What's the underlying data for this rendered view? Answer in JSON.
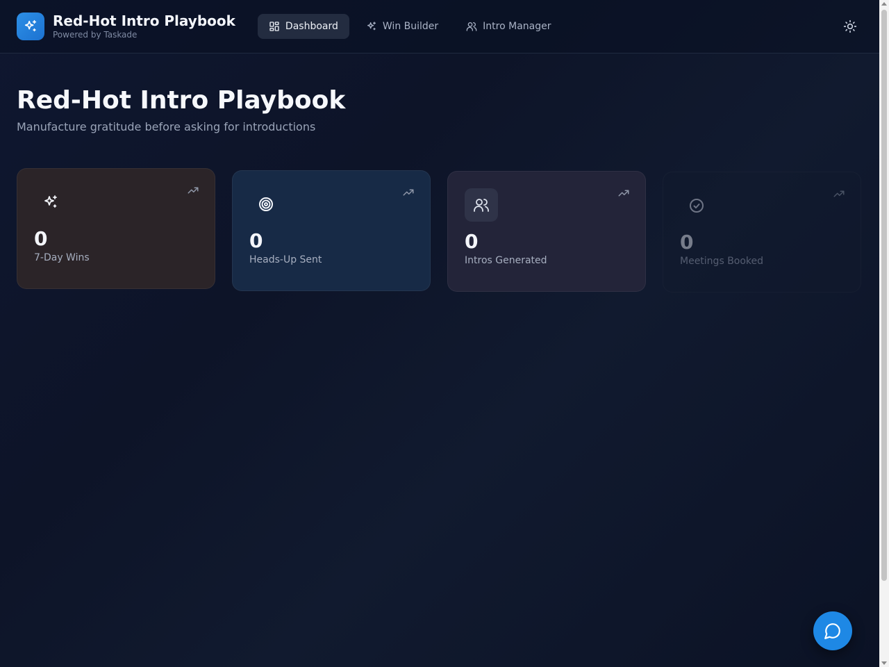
{
  "header": {
    "app_title": "Red-Hot Intro Playbook",
    "app_subtitle": "Powered by Taskade",
    "logo_icon": "sparkles-icon",
    "nav": [
      {
        "label": "Dashboard",
        "icon": "grid-icon",
        "active": true
      },
      {
        "label": "Win Builder",
        "icon": "sparkles-icon",
        "active": false
      },
      {
        "label": "Intro Manager",
        "icon": "users-icon",
        "active": false
      }
    ],
    "theme_icon": "sun-icon"
  },
  "main": {
    "title": "Red-Hot Intro Playbook",
    "subtitle": "Manufacture gratitude before asking for introductions",
    "stats": [
      {
        "value": "0",
        "label": "7-Day Wins",
        "icon": "sparkles-icon",
        "color": "#2b2428"
      },
      {
        "value": "0",
        "label": "Heads-Up Sent",
        "icon": "target-icon",
        "color": "#172a46"
      },
      {
        "value": "0",
        "label": "Intros Generated",
        "icon": "users-icon",
        "color": "#232439"
      },
      {
        "value": "0",
        "label": "Meetings Booked",
        "icon": "check-circle-icon",
        "color": "#121a2d"
      }
    ]
  },
  "chat": {
    "icon": "chat-bubble-icon",
    "color": "#1e88e5"
  },
  "colors": {
    "accent": "#1e88e5",
    "background": "#0f1730"
  }
}
